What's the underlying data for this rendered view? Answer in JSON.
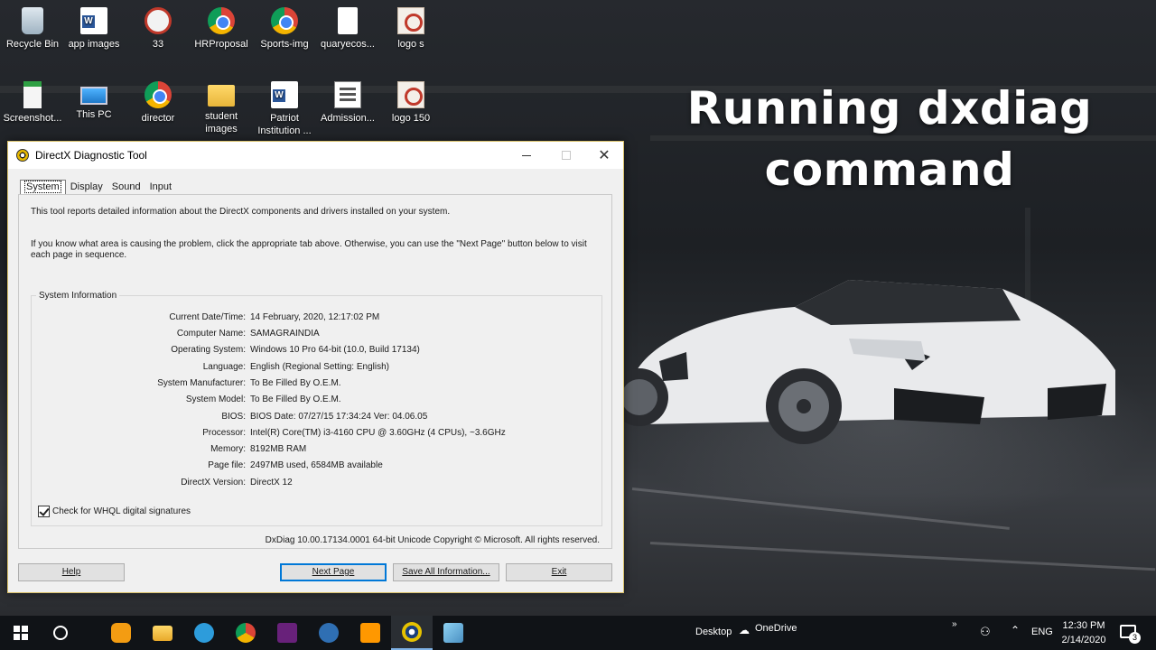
{
  "desktop": {
    "headline_line1": "Running dxdiag",
    "headline_line2": "command",
    "icons": [
      {
        "label": "Recycle Bin",
        "icon": "recycle-bin-icon"
      },
      {
        "label": "app images",
        "icon": "word-document-icon"
      },
      {
        "label": "33",
        "icon": "seal-image-icon"
      },
      {
        "label": "HRProposal",
        "icon": "chrome-icon"
      },
      {
        "label": "Sports-img",
        "icon": "chrome-icon"
      },
      {
        "label": "quaryecos...",
        "icon": "blank-document-icon"
      },
      {
        "label": "logo s",
        "icon": "logo-image-icon"
      },
      {
        "label": "Screenshot...",
        "icon": "screenshot-file-icon"
      },
      {
        "label": "This PC",
        "icon": "this-pc-icon"
      },
      {
        "label": "director",
        "icon": "chrome-icon"
      },
      {
        "label": "student images",
        "icon": "folder-icon"
      },
      {
        "label": "Patriot Institution ...",
        "icon": "word-document-icon"
      },
      {
        "label": "Admission...",
        "icon": "form-document-icon"
      },
      {
        "label": "logo 150",
        "icon": "logo-image-icon"
      }
    ]
  },
  "window": {
    "title": "DirectX Diagnostic Tool",
    "tabs": [
      "System",
      "Display",
      "Sound",
      "Input"
    ],
    "active_tab": "System",
    "intro_text": "This tool reports detailed information about the DirectX components and drivers installed on your system.",
    "intro_text2": "If you know what area is causing the problem, click the appropriate tab above.  Otherwise, you can use the \"Next Page\" button below to visit each page in sequence.",
    "group_title": "System Information",
    "rows": [
      {
        "label": "Current Date/Time:",
        "value": "14 February, 2020, 12:17:02 PM"
      },
      {
        "label": "Computer Name:",
        "value": "SAMAGRAINDIA"
      },
      {
        "label": "Operating System:",
        "value": "Windows 10 Pro 64-bit (10.0, Build 17134)"
      },
      {
        "label": "Language:",
        "value": "English (Regional Setting: English)"
      },
      {
        "label": "System Manufacturer:",
        "value": "To Be Filled By O.E.M."
      },
      {
        "label": "System Model:",
        "value": "To Be Filled By O.E.M."
      },
      {
        "label": "BIOS:",
        "value": "BIOS Date: 07/27/15 17:34:24 Ver: 04.06.05"
      },
      {
        "label": "Processor:",
        "value": "Intel(R) Core(TM) i3-4160 CPU @ 3.60GHz (4 CPUs), ~3.6GHz"
      },
      {
        "label": "Memory:",
        "value": "8192MB RAM"
      },
      {
        "label": "Page file:",
        "value": "2497MB used, 6584MB available"
      },
      {
        "label": "DirectX Version:",
        "value": "DirectX 12"
      }
    ],
    "whql_checkbox_label": "Check for WHQL digital signatures",
    "whql_checked": true,
    "copyright": "DxDiag 10.00.17134.0001 64-bit Unicode  Copyright © Microsoft. All rights reserved.",
    "buttons": {
      "help": "Help",
      "next_page": "Next Page",
      "save_all": "Save All Information...",
      "exit": "Exit"
    }
  },
  "taskbar": {
    "desktop_label": "Desktop",
    "onedrive_label": "OneDrive",
    "language": "ENG",
    "time": "12:30 PM",
    "date": "2/14/2020",
    "notification_count": "3",
    "pinned": [
      "uc-browser-icon",
      "file-explorer-icon",
      "ccleaner-icon",
      "chrome-icon",
      "visual-studio-icon",
      "directx-setup-icon",
      "sublime-text-icon",
      "dxdiag-icon",
      "notepad-3d-icon"
    ],
    "active_app": "dxdiag-icon"
  }
}
